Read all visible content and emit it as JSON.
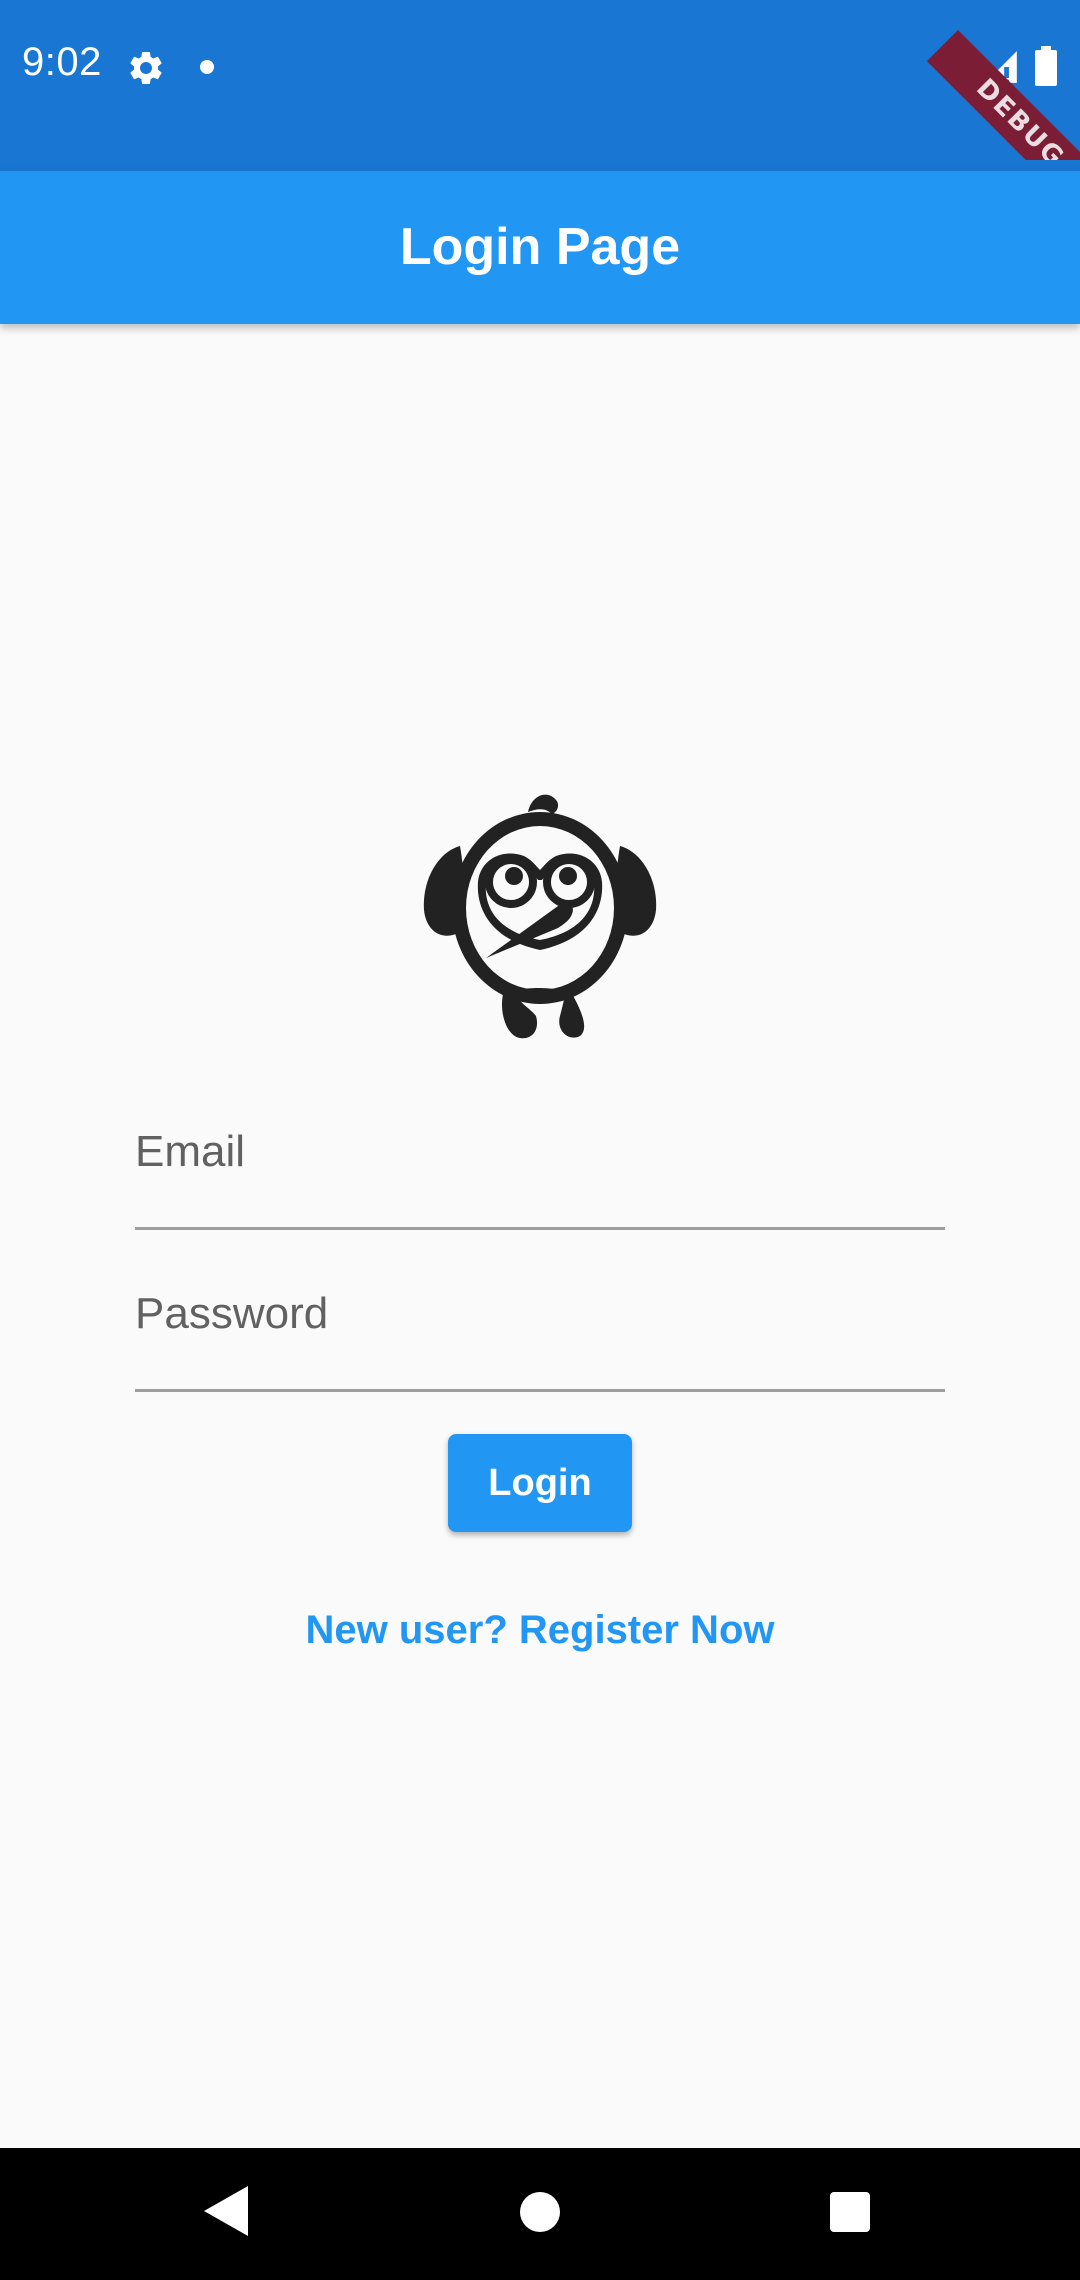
{
  "status_bar": {
    "time": "9:02",
    "icons": [
      "gear-icon",
      "notification-dot-icon",
      "wifi-icon",
      "signal-icon",
      "battery-icon"
    ]
  },
  "debug_banner": {
    "label": "DEBUG"
  },
  "app_bar": {
    "title": "Login Page",
    "color": "#2196f3"
  },
  "logo": {
    "icon": "bird-logo-icon"
  },
  "form": {
    "email": {
      "placeholder": "Email",
      "value": ""
    },
    "password": {
      "placeholder": "Password",
      "value": ""
    },
    "login_label": "Login",
    "register_label": "New user? Register Now"
  },
  "nav_bar": {
    "icons": [
      "back-icon",
      "home-icon",
      "recents-icon"
    ]
  },
  "colors": {
    "status_bar": "#1976d2",
    "accent": "#2196f3",
    "background": "#fafafa",
    "debug_ribbon": "#7a1d35"
  }
}
